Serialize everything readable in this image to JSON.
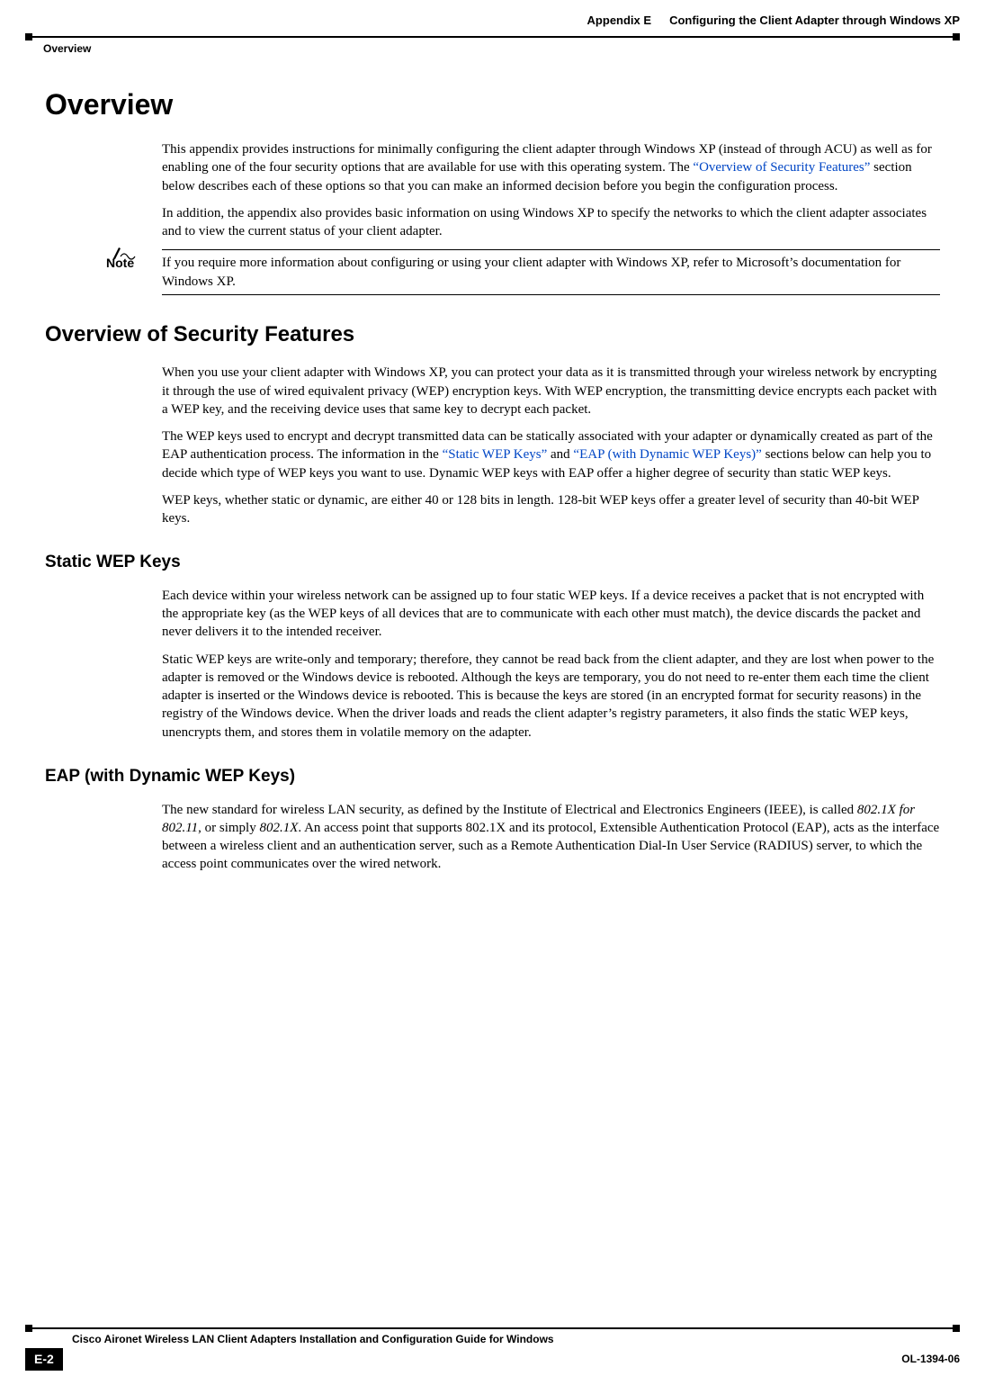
{
  "header": {
    "appendix": "Appendix E",
    "title": "Configuring the Client Adapter through Windows XP",
    "section": "Overview"
  },
  "h1": "Overview",
  "overview_p1_a": "This appendix provides instructions for minimally configuring the client adapter through Windows XP (instead of through ACU) as well as for enabling one of the four security options that are available for use with this operating system. The ",
  "overview_p1_link": "“Overview of Security Features”",
  "overview_p1_b": " section below describes each of these options so that you can make an informed decision before you begin the configuration process.",
  "overview_p2": "In addition, the appendix also provides basic information on using Windows XP to specify the networks to which the client adapter associates and to view the current status of your client adapter.",
  "note_label": "Note",
  "note_text": "If you require more information about configuring or using your client adapter with Windows XP, refer to Microsoft’s documentation for Windows XP.",
  "h2_security": "Overview of Security Features",
  "security_p1": "When you use your client adapter with Windows XP, you can protect your data as it is transmitted through your wireless network by encrypting it through the use of wired equivalent privacy (WEP) encryption keys. With WEP encryption, the transmitting device encrypts each packet with a WEP key, and the receiving device uses that same key to decrypt each packet.",
  "security_p2_a": "The WEP keys used to encrypt and decrypt transmitted data can be statically associated with your adapter or dynamically created as part of the EAP authentication process. The information in the ",
  "security_p2_link1": "“Static WEP Keys”",
  "security_p2_mid": " and ",
  "security_p2_link2": "“EAP (with Dynamic WEP Keys)”",
  "security_p2_b": " sections below can help you to decide which type of WEP keys you want to use. Dynamic WEP keys with EAP offer a higher degree of security than static WEP keys.",
  "security_p3": "WEP keys, whether static or dynamic, are either 40 or 128 bits in length. 128-bit WEP keys offer a greater level of security than 40-bit WEP keys.",
  "h3_static": "Static WEP Keys",
  "static_p1": "Each device within your wireless network can be assigned up to four static WEP keys. If a device receives a packet that is not encrypted with the appropriate key (as the WEP keys of all devices that are to communicate with each other must match), the device discards the packet and never delivers it to the intended receiver.",
  "static_p2": "Static WEP keys are write-only and temporary; therefore, they cannot be read back from the client adapter, and they are lost when power to the adapter is removed or the Windows device is rebooted. Although the keys are temporary, you do not need to re-enter them each time the client adapter is inserted or the Windows device is rebooted. This is because the keys are stored (in an encrypted format for security reasons) in the registry of the Windows device. When the driver loads and reads the client adapter’s registry parameters, it also finds the static WEP keys, unencrypts them, and stores them in volatile memory on the adapter.",
  "h3_eap": "EAP (with Dynamic WEP Keys)",
  "eap_p1_a": "The new standard for wireless LAN security, as defined by the Institute of Electrical and Electronics Engineers (IEEE), is called ",
  "eap_p1_i1": "802.1X for 802.11",
  "eap_p1_b": ", or simply ",
  "eap_p1_i2": "802.1X",
  "eap_p1_c": ". An access point that supports 802.1X and its protocol, Extensible Authentication Protocol (EAP), acts as the interface between a wireless client and an authentication server, such as a Remote Authentication Dial-In User Service (RADIUS) server, to which the access point communicates over the wired network.",
  "footer": {
    "book_title": "Cisco Aironet Wireless LAN Client Adapters Installation and Configuration Guide for Windows",
    "page_num": "E-2",
    "doc_id": "OL-1394-06"
  }
}
